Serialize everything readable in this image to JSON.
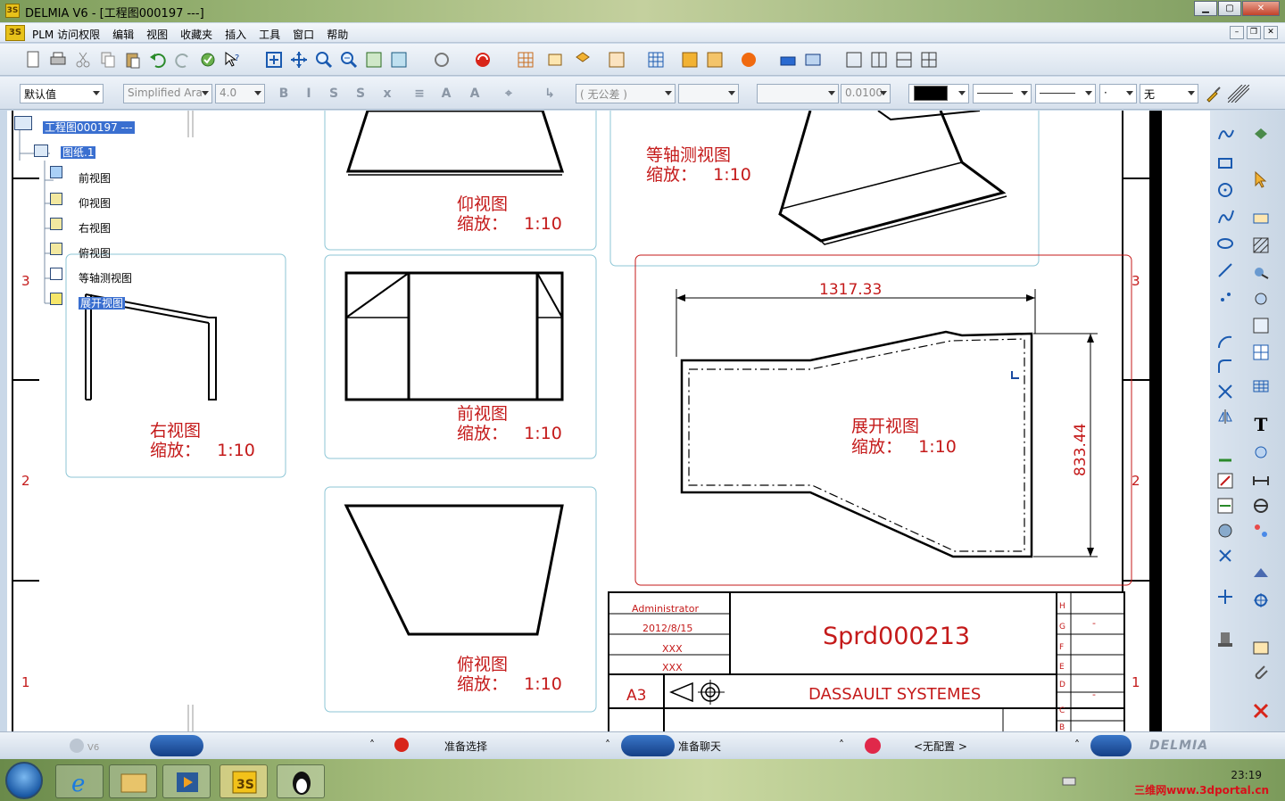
{
  "window": {
    "title": "DELMIA V6 - [工程图000197 ---]"
  },
  "menu": [
    "PLM 访问权限",
    "编辑",
    "视图",
    "收藏夹",
    "插入",
    "工具",
    "窗口",
    "帮助"
  ],
  "toolbar2": {
    "style": "默认值",
    "font": "Simplified Ara",
    "size": "4.0",
    "tolerance": "( 无公差 )",
    "precision": "0.0100",
    "pattern": "无"
  },
  "tree": {
    "root": "工程图000197 ---",
    "sheet": "图纸.1",
    "views": [
      "前视图",
      "仰视图",
      "右视图",
      "俯视图",
      "等轴测视图",
      "展开视图"
    ]
  },
  "drawing": {
    "zone_numbers_left": [
      "3",
      "2",
      "1"
    ],
    "zone_numbers_right": [
      "3",
      "2",
      "1"
    ],
    "views": {
      "bottom": {
        "name": "仰视图",
        "scale": "缩放：   1:10"
      },
      "iso": {
        "name": "等轴测视图",
        "scale": "缩放：   1:10"
      },
      "right": {
        "name": "右视图",
        "scale": "缩放：   1:10"
      },
      "front": {
        "name": "前视图",
        "scale": "缩放：   1:10"
      },
      "top": {
        "name": "俯视图",
        "scale": "缩放：   1:10"
      },
      "unfolded": {
        "name": "展开视图",
        "scale": "缩放：   1:10"
      }
    },
    "dimensions": {
      "width": "1317.33",
      "height": "833.44"
    },
    "title_block": {
      "designer": "Administrator",
      "date": "2012/8/15",
      "checker": "XXX",
      "approver": "XXX",
      "size": "A3",
      "part_number": "Sprd000213",
      "company": "DASSAULT SYSTEMES",
      "revisions": [
        "H",
        "G",
        "F",
        "E",
        "D",
        "C",
        "B"
      ],
      "rev_dash": "-"
    }
  },
  "status": {
    "select": "准备选择",
    "chat": "准备聊天",
    "config": "<无配置 >",
    "brand": "DELMIA"
  },
  "taskbar": {
    "time": "23:19",
    "watermark": "三维网www.3dportal.cn"
  },
  "colors": {
    "drawing_red": "#c41a1a",
    "frame_blue": "#8cc6d6",
    "highlight": "#3a6fd0"
  }
}
